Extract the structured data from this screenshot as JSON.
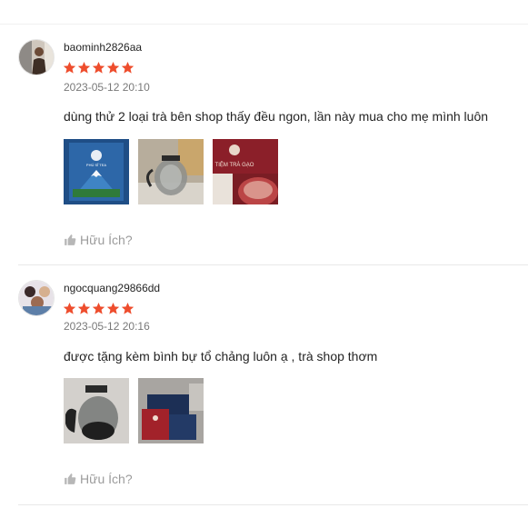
{
  "reviews": [
    {
      "username": "baominh2826aa",
      "rating": 5,
      "time": "2023-05-12 20:10",
      "comment": "dùng thử 2 loại trà bên shop thấy đều ngon, lần này mua cho mẹ mình luôn",
      "photos": [
        "tea-box-photo",
        "glass-teapot-photo",
        "tea-brand-box-photo"
      ],
      "photo_text": {
        "brand": "TIỆM TRÀ GẠO",
        "small": "PHÚ SĨ TEA"
      },
      "helpful_label": "Hữu Ích?"
    },
    {
      "username": "ngocquang29866dd",
      "rating": 5,
      "time": "2023-05-12 20:16",
      "comment": "được tặng kèm bình bự tổ chảng luôn ạ , trà shop thơm",
      "photos": [
        "glass-teapot-photo",
        "tea-package-photo"
      ],
      "helpful_label": "Hữu Ích?"
    }
  ],
  "colors": {
    "star": "#ee4d2d",
    "helpful": "#b7b7b7"
  }
}
